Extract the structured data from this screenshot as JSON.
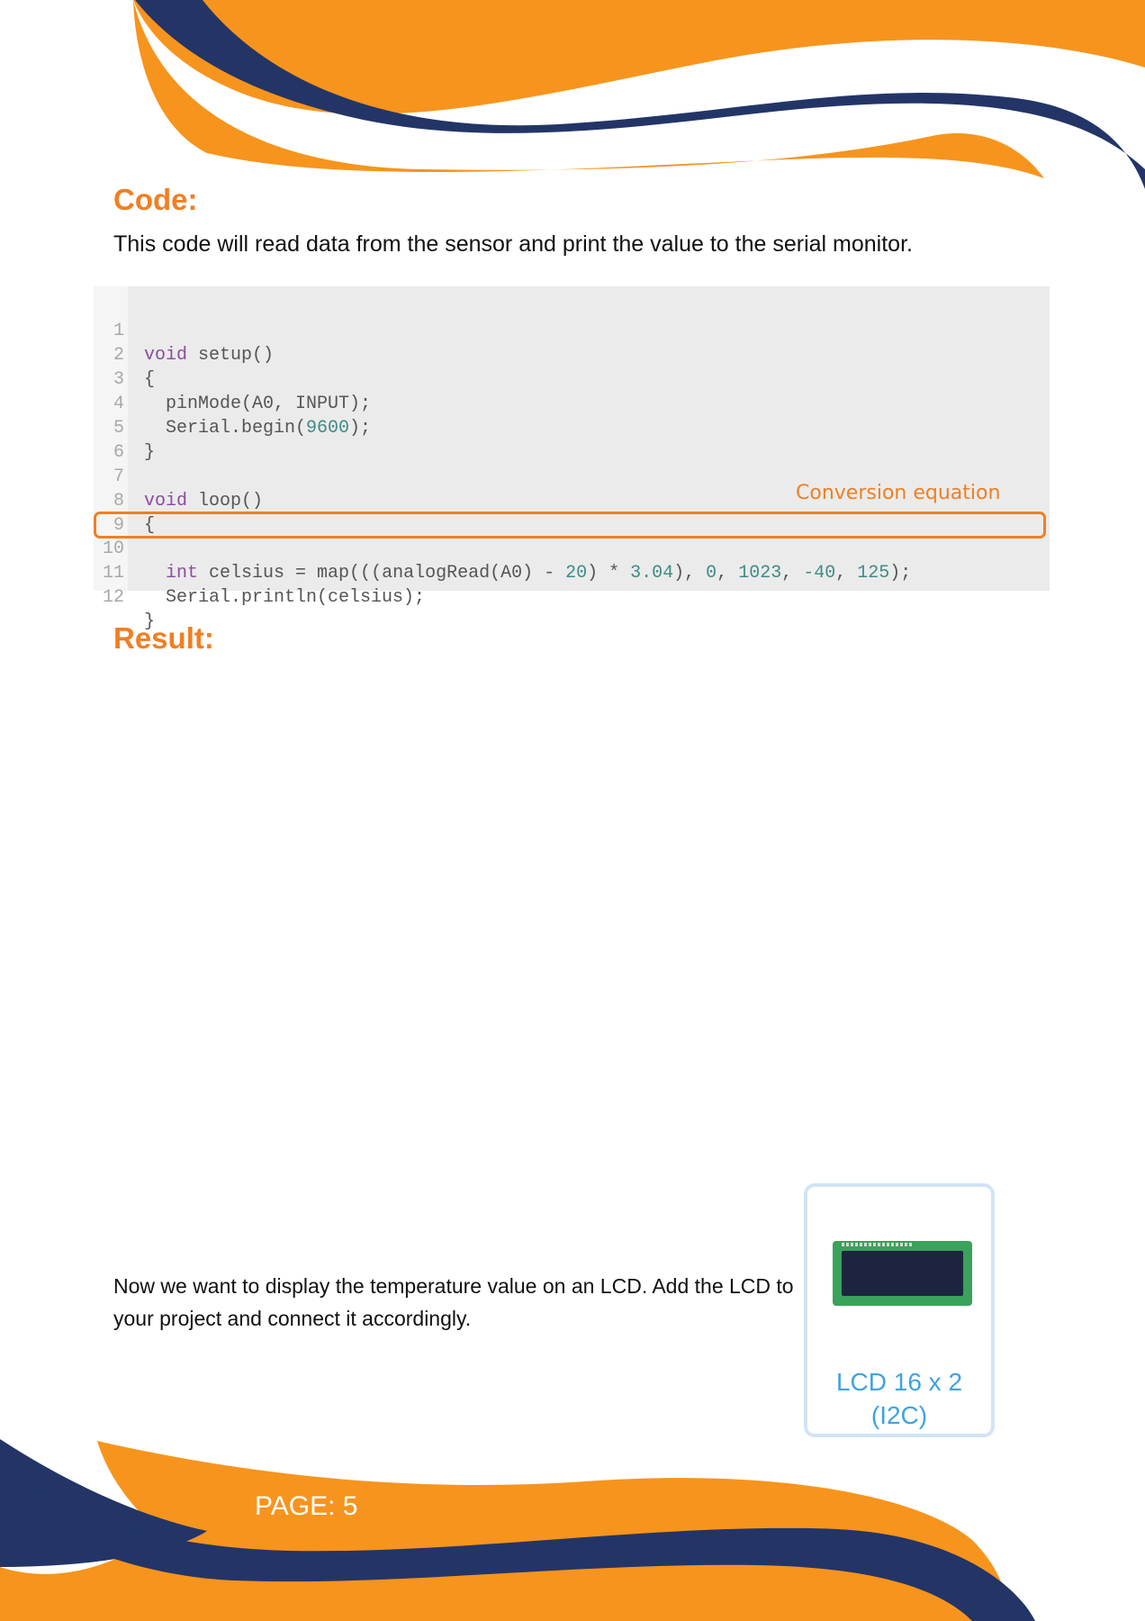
{
  "headings": {
    "code": "Code:",
    "result": "Result:"
  },
  "intro_text": "This code will read data from the sensor and print the value to the serial monitor.",
  "code": {
    "line_numbers": [
      "1",
      "2",
      "3",
      "4",
      "5",
      "6",
      "7",
      "8",
      "9",
      "10",
      "11",
      "12"
    ],
    "lines": [
      "void setup()",
      "{",
      "  pinMode(A0, INPUT);",
      "  Serial.begin(9600);",
      "}",
      "",
      "void loop()",
      "{",
      "",
      "  int celsius = map(((analogRead(A0) - 20) * 3.04), 0, 1023, -40, 125);",
      "  Serial.println(celsius);",
      "}"
    ],
    "highlight_line": 10,
    "annotation": "Conversion equation"
  },
  "lcd_text": "Now we want to display the temperature value on an LCD. Add the LCD to your project and connect it accordingly.",
  "lcd_card": {
    "caption_line1": "LCD 16 x 2",
    "caption_line2": "(I2C)"
  },
  "footer": {
    "page_label": "PAGE: 5"
  },
  "colors": {
    "orange": "#f7941d",
    "navy": "#233567",
    "heading": "#f07f22",
    "lcd_caption": "#3fa3e0"
  }
}
